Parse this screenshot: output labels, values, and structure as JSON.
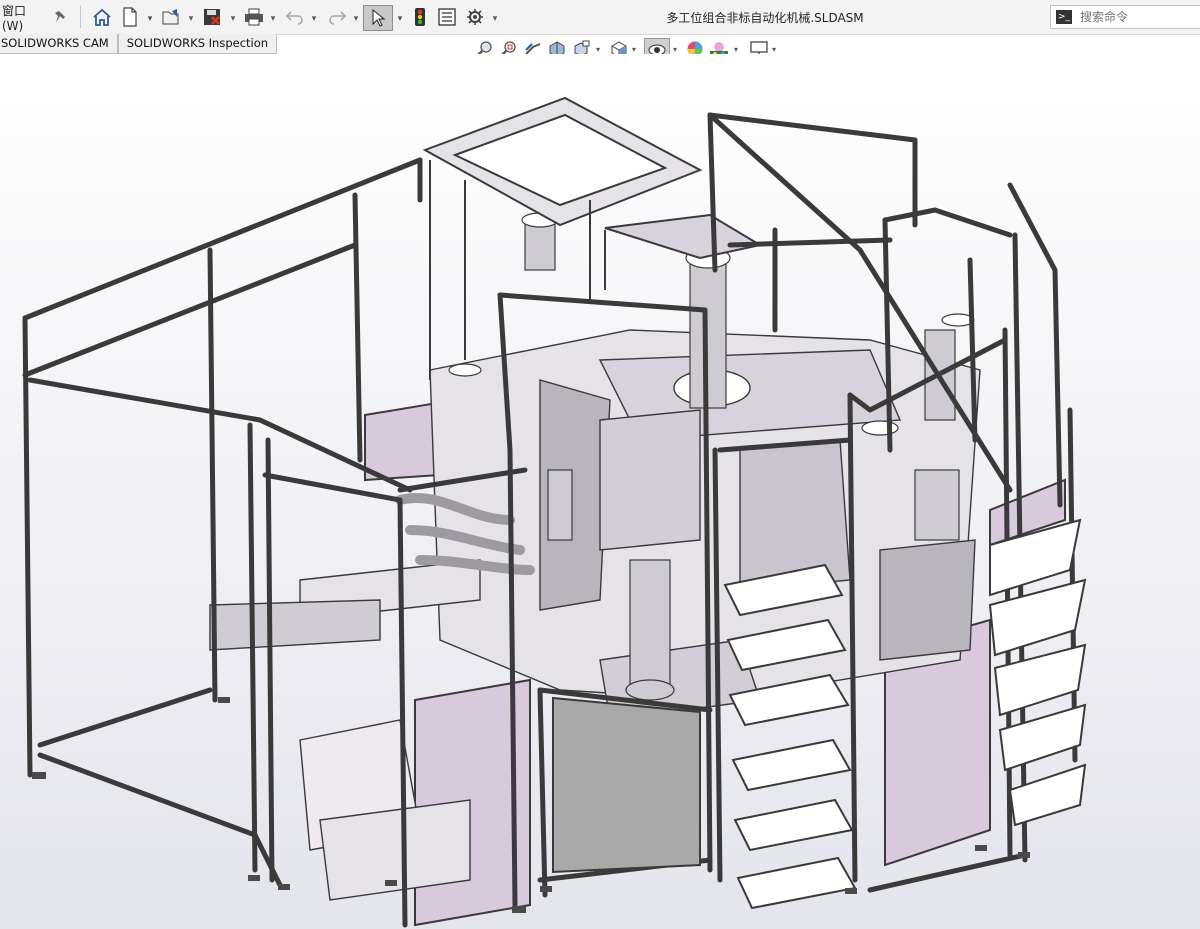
{
  "title_bar": {
    "window_menu_label": "窗口(W)",
    "document_title": "多工位组合非标自动化机械.SLDASM",
    "search": {
      "placeholder": "搜索命令"
    }
  },
  "command_manager_tabs": [
    {
      "label": "SOLIDWORKS CAM"
    },
    {
      "label": "SOLIDWORKS Inspection"
    }
  ],
  "toolbar_icons": [
    "pin-icon",
    "home-icon",
    "new-document-icon",
    "open-icon",
    "save-icon",
    "print-icon",
    "undo-icon",
    "redo-icon",
    "select-icon",
    "rebuild-icon",
    "file-properties-icon",
    "options-icon"
  ],
  "heads_up_icons": [
    "zoom-to-fit-icon",
    "zoom-to-area-icon",
    "previous-view-icon",
    "section-view-icon",
    "dynamic-annotation-icon",
    "view-orientation-icon",
    "display-style-icon",
    "hide-show-items-icon",
    "edit-appearance-icon",
    "apply-scene-icon",
    "view-settings-icon"
  ],
  "colors": {
    "frame": "#3a3a3a",
    "panel_lilac": "#d9c9dd",
    "panel_gray": "#a9a9a9",
    "machine_light": "#e6e3e8",
    "machine_mid": "#b9b5bd",
    "background_top": "#ffffff",
    "background_bottom": "#e2e2ea"
  }
}
